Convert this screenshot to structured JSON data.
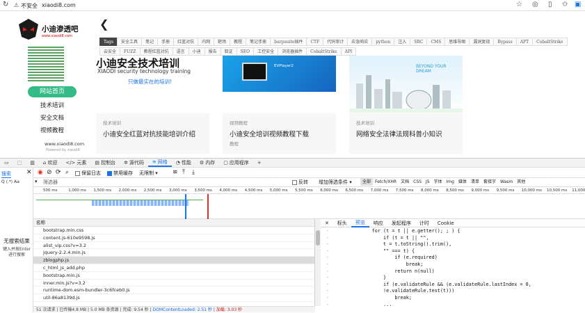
{
  "browser": {
    "security_label": "不安全",
    "url": "xiaodi8.com"
  },
  "site": {
    "logo_text": "小迪渗透吧",
    "logo_sub": "www.xiaodi8.com",
    "nav": [
      "网站首页",
      "技术培训",
      "安全文档",
      "视频教程"
    ],
    "footer_url": "www.xiaodi8.com",
    "powered": "Powered by xiaodi8",
    "tags_row1": [
      "Tags",
      "安全工具",
      "笔记",
      "手册",
      "红蓝对抗",
      "内网",
      "靶场",
      "教程",
      "笔记手册",
      "burpsuite插件",
      "CTF",
      "代码审计",
      "应急响应",
      "python",
      "注入",
      "SRC",
      "CMS",
      "思维导图",
      "漏洞复现",
      "Bypass",
      "APT",
      "CobaltStrike"
    ],
    "tags_row2": [
      "云安全",
      "FUZZ",
      "教程红蓝对抗",
      "语言",
      "小迪",
      "报告",
      "取证",
      "SEO",
      "工控安全",
      "浏览器插件",
      "CobaltStrike",
      "API"
    ],
    "banners": [
      {
        "title": "小迪安全技术培训",
        "sub": "XIAODI security technology training",
        "link": "只做最实在的培训!"
      },
      {
        "title": "EVPlayer2"
      },
      {
        "title": "BEYOND YOUR DREAM"
      }
    ],
    "cards": [
      {
        "tag": "技术培训",
        "title": "小迪安全红蓝对抗技能培训介绍",
        "sub": ""
      },
      {
        "tag": "视频教程",
        "title": "小迪安全培训视频教程下载",
        "sub": "教程"
      },
      {
        "tag": "技术培训",
        "title": "网络安全法律法规科普小知识",
        "sub": ""
      }
    ]
  },
  "devtools": {
    "tabs": [
      "欢迎",
      "元素",
      "控制台",
      "源代码",
      "网络",
      "性能",
      "内存",
      "应用程序"
    ],
    "active_tab": "网络",
    "search_label": "搜索",
    "toolbar": {
      "preserve_log": "保留日志",
      "disable_cache": "禁用缓存",
      "throttle": "无限制"
    },
    "filter": {
      "placeholder": "筛选器",
      "invert": "反转",
      "more": "增加筛选条件",
      "types": [
        "全部",
        "Fetch/XHR",
        "文档",
        "CSS",
        "JS",
        "字体",
        "Img",
        "媒体",
        "清单",
        "套接字",
        "Wasm",
        "其他"
      ]
    },
    "search_pane": {
      "title": "无搜索结果",
      "hint": "键入并按Enter进行搜索"
    },
    "ruler": [
      "500 ms",
      "1,000 ms",
      "1,500 ms",
      "2,000 ms",
      "2,500 ms",
      "3,000 ms",
      "3,500 ms",
      "4,000 ms",
      "4,500 ms",
      "5,000 ms",
      "5,500 ms",
      "6,000 ms",
      "6,500 ms",
      "7,000 ms",
      "7,500 ms",
      "8,000 ms",
      "8,500 ms",
      "9,000 ms",
      "9,500 ms",
      "10,000 ms",
      "10,500 ms",
      "11,000 ms"
    ],
    "list_header": "名称",
    "requests": [
      "bootstrap.min.css",
      "content.js-610e9598.js",
      "alist_vip.css?v=3.2",
      "jquery-2.2.4.min.js",
      "zblogphp.js",
      "c_html_js_add.php",
      "bootstrap.min.js",
      "inner.min.js?v=3.2",
      "runtime-dom.esm-bundler-3c6fceb0.js",
      "util-86a8139d.js"
    ],
    "selected_request": "zblogphp.js",
    "detail_tabs": [
      "标头",
      "预览",
      "响应",
      "发起程序",
      "计时",
      "Cookie"
    ],
    "detail_active": "预览",
    "code": [
      "for (t = t || e.getter(); ; ) {",
      "    if (t = t || \"\",",
      "    t = t.toString().trim(),",
      "    \"\" === t) {",
      "        if (e.required)",
      "            break;",
      "        return n(null)",
      "    }",
      "    if (e.validateRule && (e.validateRule.lastIndex = 0,",
      "    !e.validateRule.test(t)))",
      "        break;",
      "    ..."
    ],
    "status": {
      "requests": "51 次请求",
      "transferred": "已传输4.8 MB",
      "resources": "5.0 MB 条资源",
      "finish": "完成: 9.54 秒",
      "dcl": "DOMContentLoaded: 2.51 秒",
      "load": "加载: 3.03 秒"
    }
  }
}
